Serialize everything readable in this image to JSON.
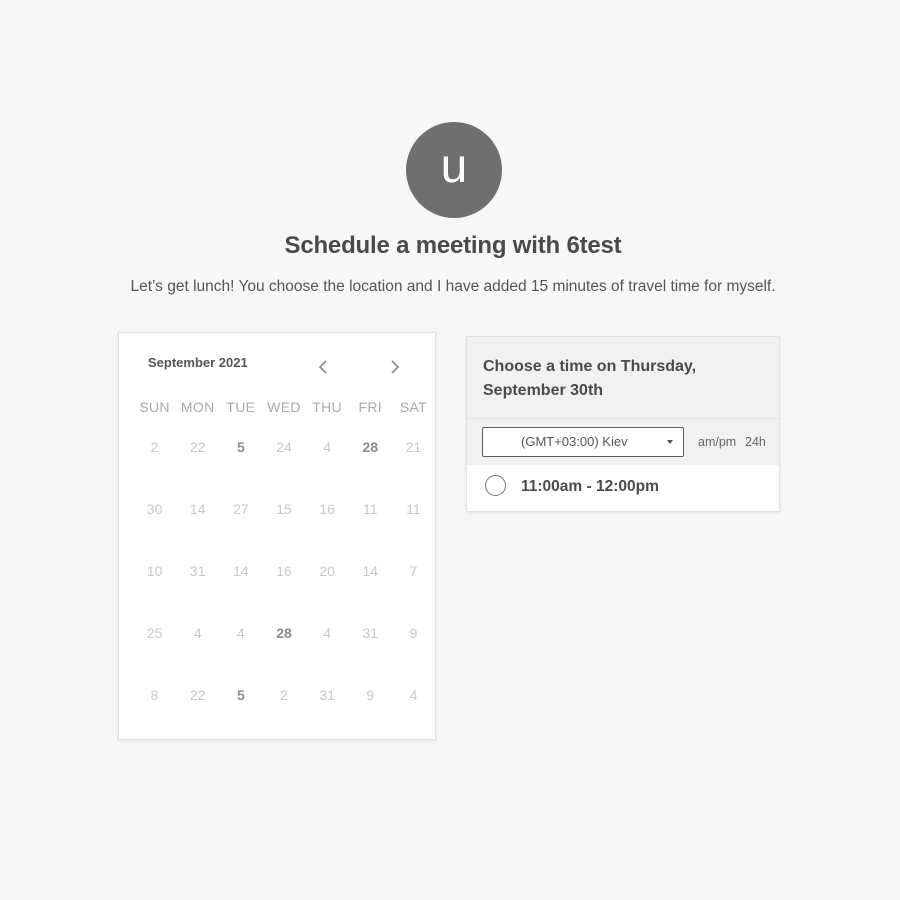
{
  "avatar": {
    "initial": "u",
    "color": "#6f6f6f"
  },
  "title": "Schedule a meeting with 6test",
  "subtitle": "Let’s get lunch! You choose the location and I have added 15 minutes of travel time for myself.",
  "calendar": {
    "month_label": "September 2021",
    "prev_icon": "chevron-left-icon",
    "next_icon": "chevron-right-icon",
    "weekdays": [
      "SUN",
      "MON",
      "TUE",
      "WED",
      "THU",
      "FRI",
      "SAT"
    ],
    "weeks": [
      [
        {
          "d": "2"
        },
        {
          "d": "22"
        },
        {
          "d": "5",
          "bold": true
        },
        {
          "d": "24"
        },
        {
          "d": "4"
        },
        {
          "d": "28",
          "bold": true
        },
        {
          "d": "21"
        }
      ],
      [
        {
          "d": "30"
        },
        {
          "d": "14"
        },
        {
          "d": "27"
        },
        {
          "d": "15"
        },
        {
          "d": "16"
        },
        {
          "d": "11"
        },
        {
          "d": "11"
        }
      ],
      [
        {
          "d": "10"
        },
        {
          "d": "31"
        },
        {
          "d": "14"
        },
        {
          "d": "16"
        },
        {
          "d": "20"
        },
        {
          "d": "14"
        },
        {
          "d": "7"
        }
      ],
      [
        {
          "d": "25"
        },
        {
          "d": "4"
        },
        {
          "d": "4"
        },
        {
          "d": "28",
          "bold": true
        },
        {
          "d": "4"
        },
        {
          "d": "31"
        },
        {
          "d": "9"
        }
      ],
      [
        {
          "d": "8"
        },
        {
          "d": "22"
        },
        {
          "d": "5",
          "bold": true
        },
        {
          "d": "2"
        },
        {
          "d": "31"
        },
        {
          "d": "9"
        },
        {
          "d": "4"
        }
      ]
    ]
  },
  "time_panel": {
    "heading": "Choose a time on Thursday, September 30th",
    "timezone": {
      "selected": "(GMT+03:00) Kiev"
    },
    "format_ampm": "am/pm",
    "format_24h": "24h",
    "slots": [
      "11:00am - 12:00pm"
    ]
  }
}
